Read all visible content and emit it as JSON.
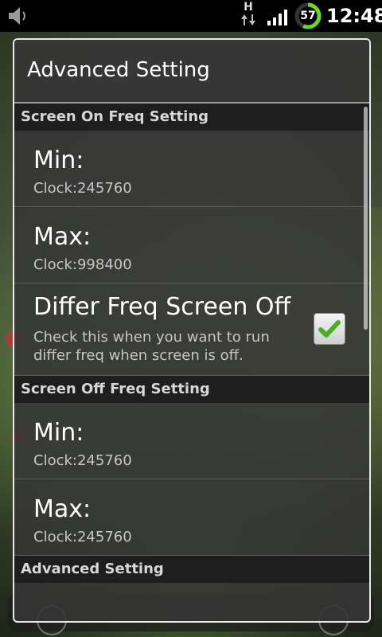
{
  "status_bar": {
    "time": "12:48",
    "battery": "57",
    "network": "H"
  },
  "dialog": {
    "title": "Advanced Setting",
    "sections": [
      {
        "header": "Screen On Freq Setting",
        "rows": [
          {
            "title": "Min:",
            "summary": "Clock:245760"
          },
          {
            "title": "Max:",
            "summary": "Clock:998400"
          },
          {
            "title": "Differ Freq Screen Off",
            "summary": "Check this when you want to run differ freq when screen is off.",
            "checked": true
          }
        ]
      },
      {
        "header": "Screen Off Freq Setting",
        "rows": [
          {
            "title": "Min:",
            "summary": "Clock:245760"
          },
          {
            "title": "Max:",
            "summary": "Clock:245760"
          }
        ]
      },
      {
        "header": "Advanced Setting",
        "rows": []
      }
    ]
  },
  "colors": {
    "checkmark": "#4caf22",
    "battery_ring": "#6bd42a"
  },
  "icons": [
    "speaker-icon",
    "hspa-icon",
    "signal-icon",
    "battery-icon",
    "checkmark-icon"
  ]
}
